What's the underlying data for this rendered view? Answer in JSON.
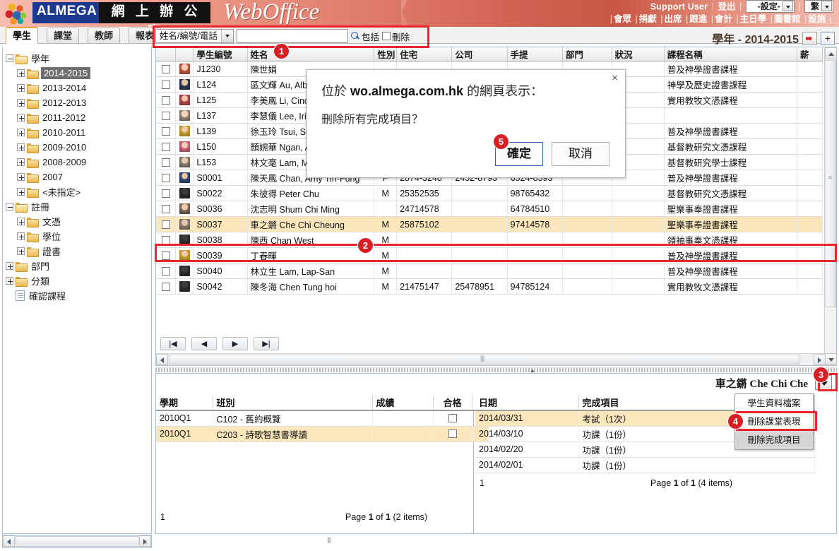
{
  "header": {
    "brand_almega": "ALMEGA",
    "brand_cn": "網 上 辦 公 室",
    "brand_webof": "WebOffice",
    "support_user": "Support User",
    "logout": "登出",
    "settings_select": "-設定-",
    "lang_select": "繁",
    "nav_items": [
      "會眾",
      "捐獻",
      "出席",
      "跟進",
      "會計",
      "主日學",
      "圖書館",
      "設施"
    ]
  },
  "tabs": [
    {
      "label": "學生",
      "active": true
    },
    {
      "label": "課堂",
      "active": false
    },
    {
      "label": "教師",
      "active": false
    },
    {
      "label": "報表",
      "active": false
    }
  ],
  "search": {
    "field_select": "姓名/編號/電話",
    "value": "",
    "placeholder": "",
    "include_label": "包括",
    "delete_label": "刪除"
  },
  "year_bar": {
    "label": "學年 - 2014-2015",
    "add_label": "+"
  },
  "sidebar": {
    "nodes": [
      {
        "label": "學年",
        "level": 0,
        "expander": "minus",
        "icon": "folder-open",
        "selected": false
      },
      {
        "label": "2014-2015",
        "level": 1,
        "expander": "plus",
        "icon": "folder",
        "selected": true
      },
      {
        "label": "2013-2014",
        "level": 1,
        "expander": "plus",
        "icon": "folder",
        "selected": false
      },
      {
        "label": "2012-2013",
        "level": 1,
        "expander": "plus",
        "icon": "folder",
        "selected": false
      },
      {
        "label": "2011-2012",
        "level": 1,
        "expander": "plus",
        "icon": "folder",
        "selected": false
      },
      {
        "label": "2010-2011",
        "level": 1,
        "expander": "plus",
        "icon": "folder",
        "selected": false
      },
      {
        "label": "2009-2010",
        "level": 1,
        "expander": "plus",
        "icon": "folder",
        "selected": false
      },
      {
        "label": "2008-2009",
        "level": 1,
        "expander": "plus",
        "icon": "folder",
        "selected": false
      },
      {
        "label": "2007",
        "level": 1,
        "expander": "plus",
        "icon": "folder",
        "selected": false
      },
      {
        "label": "<未指定>",
        "level": 1,
        "expander": "plus",
        "icon": "folder",
        "selected": false
      },
      {
        "label": "註冊",
        "level": 0,
        "expander": "minus",
        "icon": "folder-open",
        "selected": false
      },
      {
        "label": "文憑",
        "level": 1,
        "expander": "plus",
        "icon": "folder",
        "selected": false
      },
      {
        "label": "學位",
        "level": 1,
        "expander": "plus",
        "icon": "folder",
        "selected": false
      },
      {
        "label": "證書",
        "level": 1,
        "expander": "plus",
        "icon": "folder",
        "selected": false
      },
      {
        "label": "部門",
        "level": 0,
        "expander": "plus",
        "icon": "folder",
        "selected": false
      },
      {
        "label": "分類",
        "level": 0,
        "expander": "plus",
        "icon": "folder",
        "selected": false
      },
      {
        "label": "確認課程",
        "level": 0,
        "expander": "none",
        "icon": "document",
        "selected": false
      }
    ]
  },
  "grid": {
    "columns": [
      "",
      "",
      "學生編號",
      "姓名",
      "性別",
      "住宅",
      "公司",
      "手提",
      "部門",
      "狀況",
      "課程名稱",
      "薪"
    ],
    "rows": [
      {
        "id": "J1230",
        "name": "陳世娟",
        "sex": "",
        "home": "",
        "company": "",
        "mobile": "",
        "dept": "",
        "status": "",
        "course": "普及神學證書課程",
        "avatar": "av1",
        "selected": false
      },
      {
        "id": "L124",
        "name": "區文輝 Au, Albert Man-Fai",
        "sex": "",
        "home": "",
        "company": "",
        "mobile": "",
        "dept": "",
        "status": "",
        "course": "神學及歷史證書課程",
        "avatar": "av2",
        "selected": false
      },
      {
        "id": "L125",
        "name": "李美鳳 Li, Cindy Mei-Fung",
        "sex": "",
        "home": "",
        "company": "",
        "mobile": "",
        "dept": "",
        "status": "",
        "course": "實用教牧文憑課程",
        "avatar": "av3",
        "selected": false
      },
      {
        "id": "L137",
        "name": "李慧儀 Lee, Iris Wai-Yee",
        "sex": "",
        "home": "",
        "company": "",
        "mobile": "",
        "dept": "",
        "status": "",
        "course": "",
        "avatar": "av4",
        "selected": false
      },
      {
        "id": "L139",
        "name": "徐玉玲 Tsui, Susan",
        "sex": "",
        "home": "",
        "company": "",
        "mobile": "",
        "dept": "",
        "status": "",
        "course": "普及神學證書課程",
        "avatar": "av5",
        "selected": false
      },
      {
        "id": "L150",
        "name": "顏婉華 Ngan, Alice Yuen-Wah",
        "sex": "",
        "home": "",
        "company": "",
        "mobile": "",
        "dept": "",
        "status": "",
        "course": "基督教研究文憑課程",
        "avatar": "av6",
        "selected": false
      },
      {
        "id": "L153",
        "name": "林文毫 Lam, Man-Ho",
        "sex": "",
        "home": "",
        "company": "",
        "mobile": "",
        "dept": "",
        "status": "",
        "course": "基督教研究學士課程",
        "avatar": "av7",
        "selected": false
      },
      {
        "id": "S0001",
        "name": "陳天鳳 Chan, Amy Tin-Fung",
        "sex": "F",
        "home": "2874-3248",
        "company": "2452-8793",
        "mobile": "6524-8593",
        "dept": "",
        "status": "",
        "course": "普及神學證書課程",
        "avatar": "av8",
        "selected": false
      },
      {
        "id": "S0022",
        "name": "朱彼得 Peter Chu",
        "sex": "M",
        "home": "25352535",
        "company": "",
        "mobile": "98765432",
        "dept": "",
        "status": "",
        "course": "基督教研究文憑課程",
        "avatar": "avsil",
        "selected": false
      },
      {
        "id": "S0036",
        "name": "沈志明 Shum Chi Ming",
        "sex": "",
        "home": "24714578",
        "company": "",
        "mobile": "64784510",
        "dept": "",
        "status": "",
        "course": "聖樂事奉證書課程",
        "avatar": "av10",
        "selected": false
      },
      {
        "id": "S0037",
        "name": "車之鏘 Che Chi Cheung",
        "sex": "M",
        "home": "25875102",
        "company": "",
        "mobile": "97414578",
        "dept": "",
        "status": "",
        "course": "聖樂事奉證書課程",
        "avatar": "av7",
        "selected": true
      },
      {
        "id": "S0038",
        "name": "陳西 Chan West",
        "sex": "M",
        "home": "",
        "company": "",
        "mobile": "",
        "dept": "",
        "status": "",
        "course": "領袖事奉文憑課程",
        "avatar": "avsil",
        "selected": false
      },
      {
        "id": "S0039",
        "name": "丁春暉",
        "sex": "M",
        "home": "",
        "company": "",
        "mobile": "",
        "dept": "",
        "status": "",
        "course": "普及神學證書課程",
        "avatar": "av5",
        "selected": false
      },
      {
        "id": "S0040",
        "name": "林立生 Lam, Lap-San",
        "sex": "M",
        "home": "",
        "company": "",
        "mobile": "",
        "dept": "",
        "status": "",
        "course": "普及神學證書課程",
        "avatar": "avsil",
        "selected": false
      },
      {
        "id": "S0042",
        "name": "陳冬海 Chen Tung hoi",
        "sex": "M",
        "home": "21475147",
        "company": "25478951",
        "mobile": "94785124",
        "dept": "",
        "status": "",
        "course": "實用教牧文憑課程",
        "avatar": "avsil",
        "selected": false
      }
    ],
    "pager": {
      "first": "|◀",
      "prev": "◀",
      "next": "▶",
      "last": "▶|"
    }
  },
  "detail": {
    "student_title": "車之鏘 Che Chi Che",
    "context_menu": [
      {
        "label": "學生資料檔案",
        "hover": false
      },
      {
        "label": "刪除課堂表現",
        "hover": false
      },
      {
        "label": "刪除完成項目",
        "hover": true
      }
    ],
    "left_grid": {
      "columns": [
        "學期",
        "班別",
        "成績",
        "合格"
      ],
      "add_label": "+",
      "rows": [
        {
          "term": "2010Q1",
          "class": "C102 - 舊約概覽",
          "grade": "",
          "pass": false,
          "selected": false
        },
        {
          "term": "2010Q1",
          "class": "C203 - 詩歌智慧書導讀",
          "grade": "",
          "pass": false,
          "selected": true
        }
      ],
      "page_number": "1",
      "page_info_pre": "Page",
      "page_current": "1",
      "page_of": "of",
      "page_total": "1",
      "page_items": "(2 items)"
    },
    "right_grid": {
      "columns": [
        "日期",
        "完成項目"
      ],
      "rows": [
        {
          "date": "2014/03/31",
          "item": "考試（1次）",
          "selected": true
        },
        {
          "date": "2014/03/10",
          "item": "功課（1份）",
          "selected": false
        },
        {
          "date": "2014/02/20",
          "item": "功課（1份）",
          "selected": false
        },
        {
          "date": "2014/02/01",
          "item": "功課（1份）",
          "selected": false
        }
      ],
      "page_number": "1",
      "page_info_pre": "Page",
      "page_current": "1",
      "page_of": "of",
      "page_total": "1",
      "page_items": "(4 items)"
    }
  },
  "dialog": {
    "host_prefix": "位於 ",
    "host": "wo.almega.com.hk",
    "host_suffix": " 的網頁表示：",
    "message": "刪除所有完成項目？",
    "ok_label": "確定",
    "cancel_label": "取消",
    "close_label": "×"
  },
  "callouts": [
    {
      "number": "1"
    },
    {
      "number": "2"
    },
    {
      "number": "3"
    },
    {
      "number": "4"
    },
    {
      "number": "5"
    }
  ],
  "colors": {
    "accent_red": "#d81f26",
    "banner_red": "#cf5f4e",
    "highlight_row": "#fce7bd",
    "tab_active_border": "#e8a33d"
  }
}
